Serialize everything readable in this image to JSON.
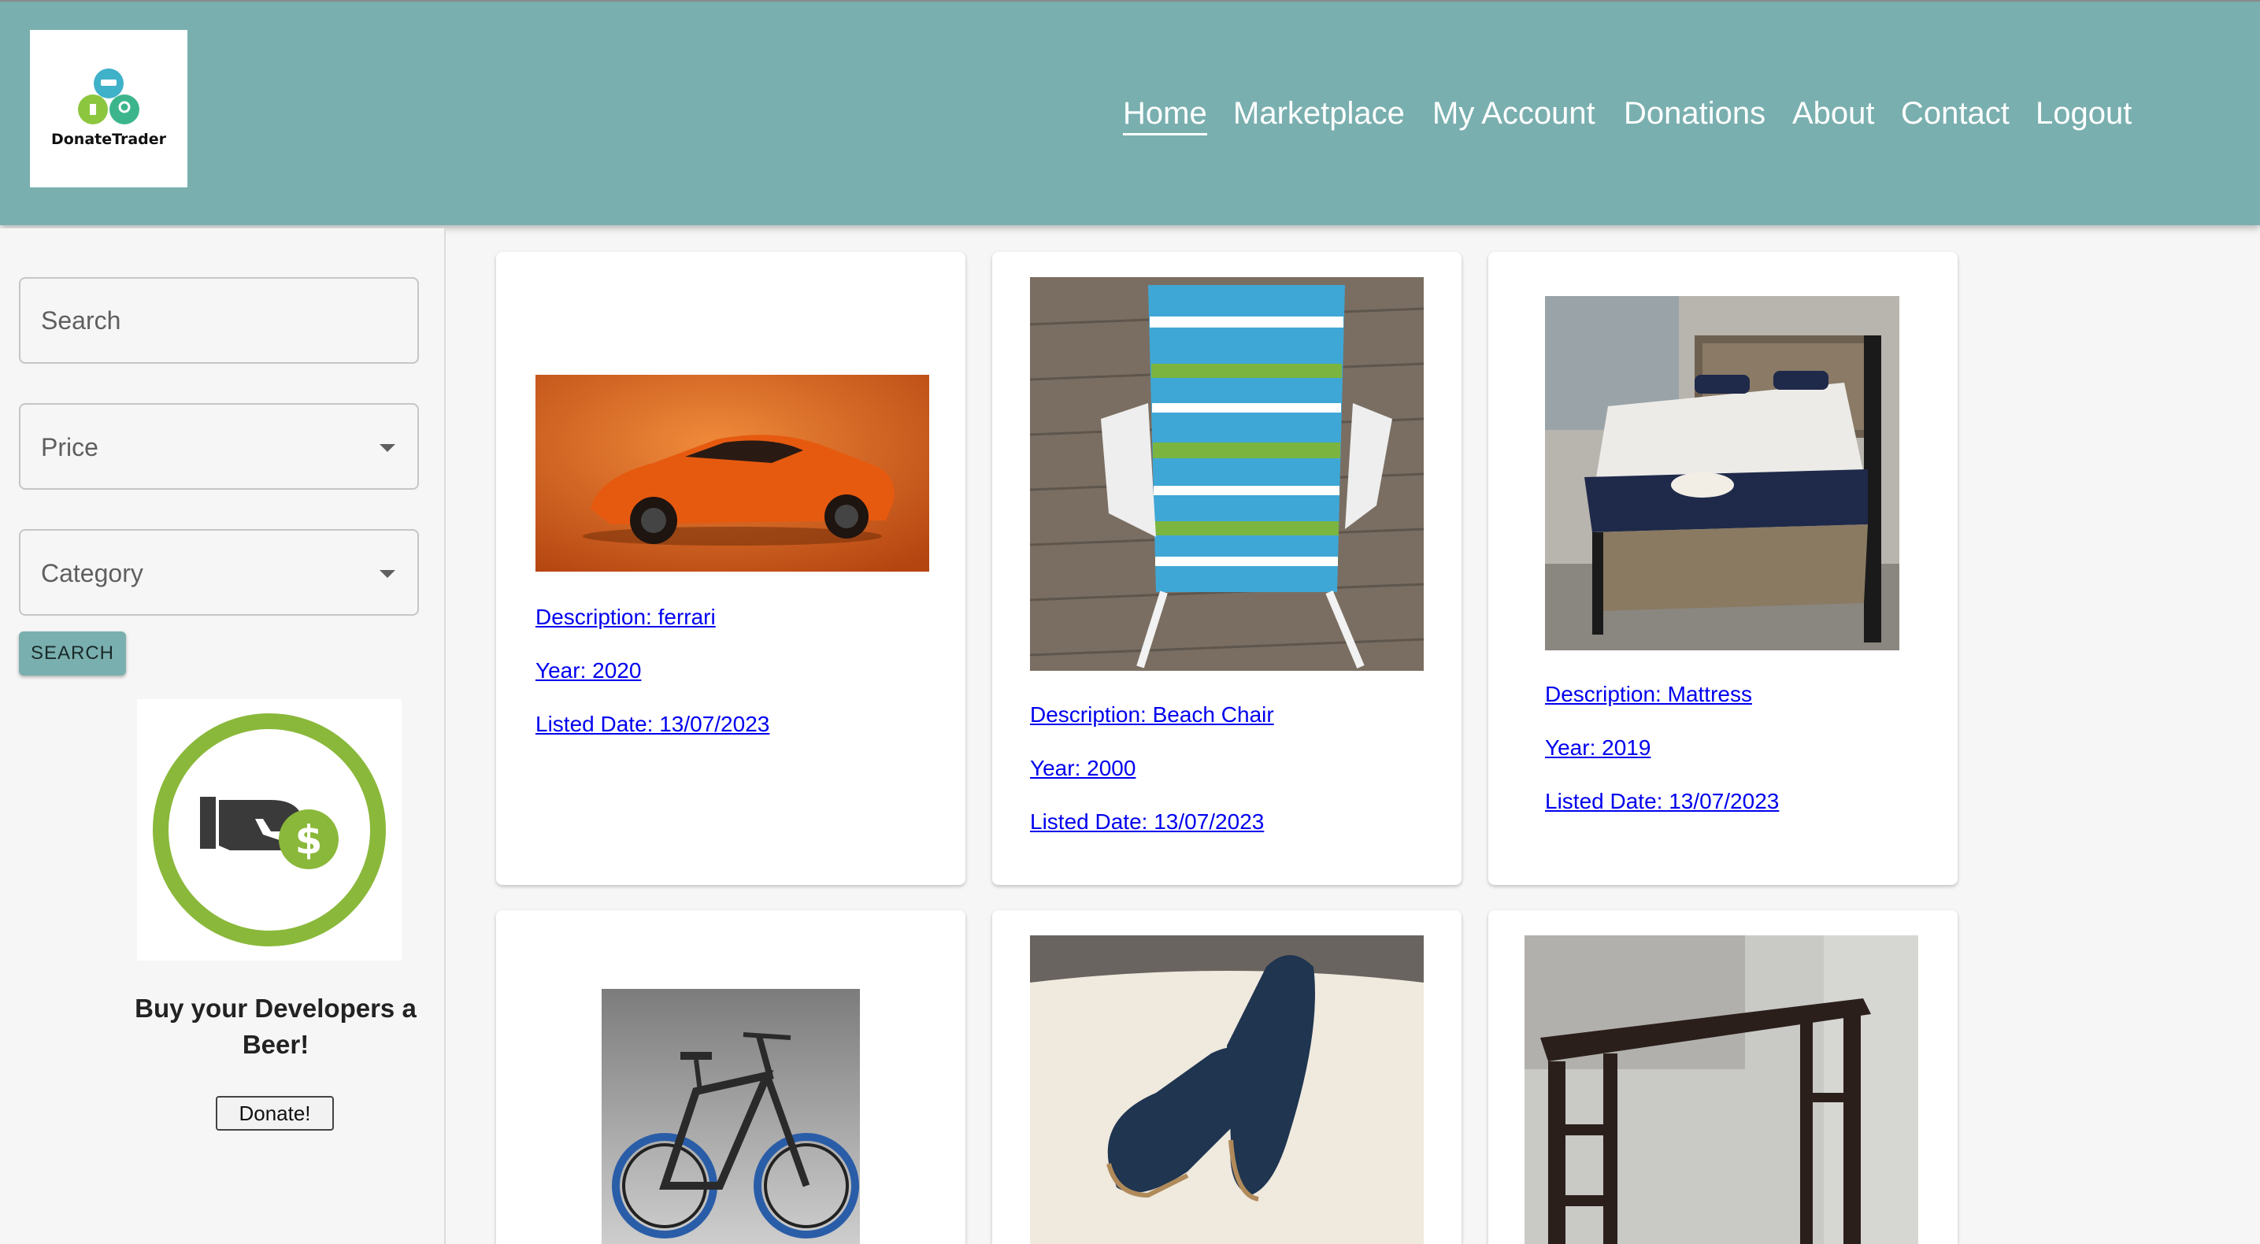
{
  "header": {
    "logo_text": "DonateTrader",
    "nav": [
      {
        "label": "Home",
        "active": true
      },
      {
        "label": "Marketplace",
        "active": false
      },
      {
        "label": "My Account",
        "active": false
      },
      {
        "label": "Donations",
        "active": false
      },
      {
        "label": "About",
        "active": false
      },
      {
        "label": "Contact",
        "active": false
      },
      {
        "label": "Logout",
        "active": false
      }
    ]
  },
  "sidebar": {
    "search_placeholder": "Search",
    "price_label": "Price",
    "category_label": "Category",
    "search_button": "SEARCH",
    "donate_title": "Buy your Developers a Beer!",
    "donate_button": "Donate!"
  },
  "listings": [
    {
      "description": "Description: ferrari",
      "year": "Year: 2020",
      "listed": "Listed Date: 13/07/2023",
      "image": "orange-sports-car"
    },
    {
      "description": "Description: Beach Chair",
      "year": "Year: 2000",
      "listed": "Listed Date: 13/07/2023",
      "image": "striped-beach-chair"
    },
    {
      "description": "Description: Mattress",
      "year": "Year: 2019",
      "listed": "Listed Date: 13/07/2023",
      "image": "bed-with-mattress"
    },
    {
      "image": "electric-bicycle"
    },
    {
      "image": "blue-suede-shoes"
    },
    {
      "image": "dark-wood-desk"
    }
  ],
  "colors": {
    "header": "#7aafaf",
    "link": "#0000ee",
    "donate_green": "#8ab83a"
  }
}
